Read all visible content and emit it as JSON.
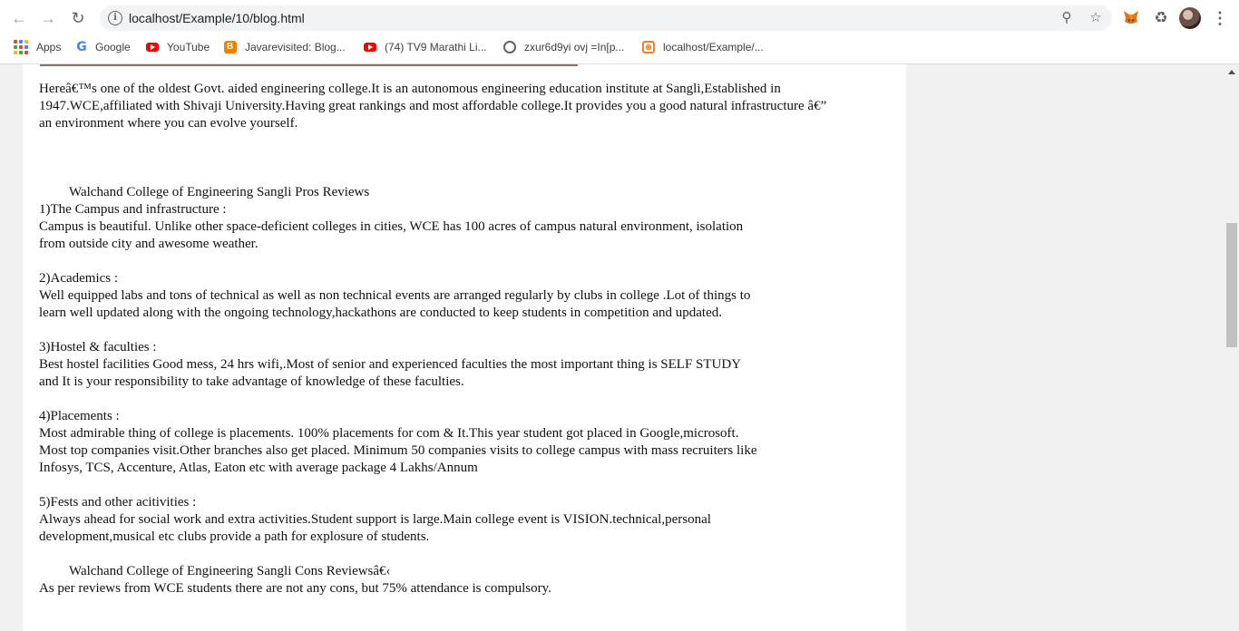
{
  "browser": {
    "url": "localhost/Example/10/blog.html",
    "bookmarks": [
      {
        "label": "Apps",
        "icon": "apps-grid-icon"
      },
      {
        "label": "Google",
        "icon": "google-icon"
      },
      {
        "label": "YouTube",
        "icon": "youtube-icon"
      },
      {
        "label": "Javarevisited: Blog...",
        "icon": "blogger-icon"
      },
      {
        "label": "(74) TV9 Marathi Li...",
        "icon": "youtube-icon"
      },
      {
        "label": "zxur6d9yi ovj =In[p...",
        "icon": "globe-icon"
      },
      {
        "label": "localhost/Example/...",
        "icon": "xampp-icon"
      }
    ]
  },
  "article": {
    "intro": "Hereâ€™s one of the oldest Govt. aided engineering college.It is an autonomous engineering education institute at Sangli,Established in\n1947.WCE,affiliated with Shivaji University.Having great rankings and most affordable college.It provides you a good natural infrastructure â€”\nan environment where you can evolve yourself.",
    "pros_heading": "Walchand College of Engineering Sangli Pros Reviews",
    "sections": [
      {
        "title": "1)The Campus and infrastructure :",
        "body": "Campus is beautiful. Unlike other space-deficient colleges in cities, WCE has 100 acres of campus natural environment, isolation\nfrom outside city and awesome weather."
      },
      {
        "title": "2)Academics :",
        "body": "Well equipped labs and tons of technical as well as non technical events are arranged regularly by clubs in college .Lot of things to\nlearn well updated along with the ongoing technology,hackathons are conducted to keep students in competition and updated."
      },
      {
        "title": "3)Hostel & faculties :",
        "body": "Best hostel facilities Good mess, 24 hrs wifi,.Most of senior and experienced faculties the most important thing is SELF STUDY\nand It is your responsibility to take advantage of knowledge of these faculties."
      },
      {
        "title": "4)Placements :",
        "body": "Most admirable thing of college is placements. 100% placements for com & It.This year  student got placed in Google,microsoft.\nMost top companies visit.Other branches also get placed. Minimum 50 companies visits to college campus with mass recruiters like\nInfosys, TCS, Accenture, Atlas, Eaton etc with average package 4 Lakhs/Annum"
      },
      {
        "title": "5)Fests and other acitivities :",
        "body": "Always ahead for social work and extra activities.Student support is large.Main college event is VISION.technical,personal\ndevelopment,musical etc clubs provide a path for explosure of students."
      }
    ],
    "cons_heading": "Walchand College of Engineering Sangli Cons Reviewsâ€‹",
    "cons_body": "As per reviews from WCE students there are not any cons, but 75% attendance is compulsory."
  },
  "colors": {
    "chrome_bg": "#ffffff",
    "page_bg": "#f1f1f1",
    "article_bg": "#ffffff",
    "text": "#111111"
  }
}
